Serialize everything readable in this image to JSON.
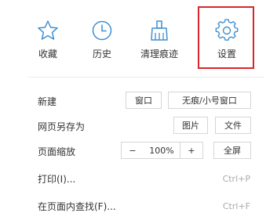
{
  "top_items": [
    {
      "label": "收藏",
      "icon": "star-icon"
    },
    {
      "label": "历史",
      "icon": "clock-icon"
    },
    {
      "label": "清理痕迹",
      "icon": "broom-icon"
    },
    {
      "label": "设置",
      "icon": "gear-icon"
    }
  ],
  "rows": {
    "new": {
      "label": "新建",
      "btn_window": "窗口",
      "btn_incognito": "无痕/小号窗口"
    },
    "save": {
      "label": "网页另存为",
      "btn_image": "图片",
      "btn_file": "文件"
    },
    "zoom": {
      "label": "页面缩放",
      "minus": "−",
      "value": "100%",
      "plus": "+",
      "fullscreen": "全屏"
    },
    "print": {
      "label": "打印(I)...",
      "shortcut": "Ctrl+P"
    },
    "find": {
      "label": "在页面内查找(F)...",
      "shortcut": "Ctrl+F"
    }
  },
  "colors": {
    "icon_blue": "#3f8fd2",
    "highlight": "#d9262c"
  }
}
